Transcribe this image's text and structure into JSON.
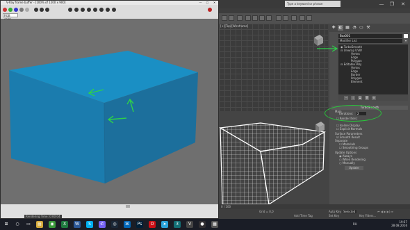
{
  "app": {
    "search_placeholder": "Type a keyword or phrase",
    "window_controls": [
      "—",
      "❐",
      "✕"
    ],
    "viewport_label": "[+][Top][Wireframe]",
    "command_panel": {
      "tabs": [
        "✚",
        "◐",
        "▦",
        "◔",
        "▭",
        "⚒"
      ],
      "object_name": "Box001",
      "object_color": "#ffffff",
      "modifier_list": "Modifier List",
      "modifier_list_arrow": "▾",
      "stack": [
        "TurboSmooth",
        "Unwrap UVW",
        "Vertex",
        "Edge",
        "Polygon",
        "Editable Poly",
        "Vertex",
        "Edge",
        "Border",
        "Polygon",
        "Element"
      ],
      "stack_tools": [
        "⊣",
        "|",
        "⧉",
        "🗑",
        "⚙"
      ],
      "rollout_turbosmooth": "TurboSmooth",
      "main_label": "Main",
      "iterations_label": "Iterations:",
      "iterations_value": "2",
      "render_iters_label": "Render Iters:",
      "isoline_display": "Isoline Display",
      "explicit_normals": "Explicit Normals",
      "surface_params": "Surface Parameters",
      "smooth_result": "Smooth Result",
      "separate": "Separate",
      "materials": "Materials",
      "smoothing_groups": "Smoothing Groups",
      "update_options": "Update Options",
      "always": "Always",
      "when_rendering": "When Rendering",
      "manually": "Manually",
      "update_button": "Update"
    },
    "timeline_text": "0 / 100",
    "status": {
      "grid": "Grid = 0,0",
      "add_time_tag": "Add Time Tag",
      "auto_key": "Auto Key",
      "set_key": "Set Key",
      "selected": "Selected",
      "key_filters": "Key Filters...",
      "rendering_time": "Rendering Time: 0:00:04"
    }
  },
  "frame_buffer": {
    "title": "V-Ray frame buffer - [100% of 1200 x 900]",
    "controls": [
      "—",
      "▢",
      "✕"
    ],
    "channel": "RGB color",
    "toolbar_icons": [
      "●",
      "●",
      "●",
      "●",
      "●",
      "●",
      "●",
      "●",
      "●",
      "●",
      "●",
      "●"
    ]
  },
  "taskbar": {
    "icons": [
      {
        "name": "start",
        "glyph": "⊞",
        "color": "#1a1d26"
      },
      {
        "name": "cortana",
        "glyph": "○",
        "color": "#1a1d26"
      },
      {
        "name": "task-view",
        "glyph": "▭",
        "color": "#1a1d26"
      },
      {
        "name": "file-explorer",
        "glyph": "▤",
        "color": "#d4a93a"
      },
      {
        "name": "chrome",
        "glyph": "◉",
        "color": "#3a9a3a"
      },
      {
        "name": "excel",
        "glyph": "X",
        "color": "#1f7a3f"
      },
      {
        "name": "word",
        "glyph": "W",
        "color": "#2b5797"
      },
      {
        "name": "skype",
        "glyph": "S",
        "color": "#00aff0"
      },
      {
        "name": "viber",
        "glyph": "✆",
        "color": "#7360f2"
      },
      {
        "name": "steam",
        "glyph": "◎",
        "color": "#1b2838"
      },
      {
        "name": "vscode",
        "glyph": "⌘",
        "color": "#0066b8"
      },
      {
        "name": "photoshop",
        "glyph": "Ps",
        "color": "#001e36"
      },
      {
        "name": "opera",
        "glyph": "O",
        "color": "#cc0f16"
      },
      {
        "name": "telegram",
        "glyph": "➤",
        "color": "#2aa1da"
      },
      {
        "name": "3dsmax",
        "glyph": "3",
        "color": "#136f76"
      },
      {
        "name": "vray",
        "glyph": "V",
        "color": "#444"
      },
      {
        "name": "obs",
        "glyph": "●",
        "color": "#302e31"
      },
      {
        "name": "files",
        "glyph": "▦",
        "color": "#555"
      }
    ],
    "tray_lang": "RU",
    "time": "19:57",
    "date": "28.08.2016"
  }
}
